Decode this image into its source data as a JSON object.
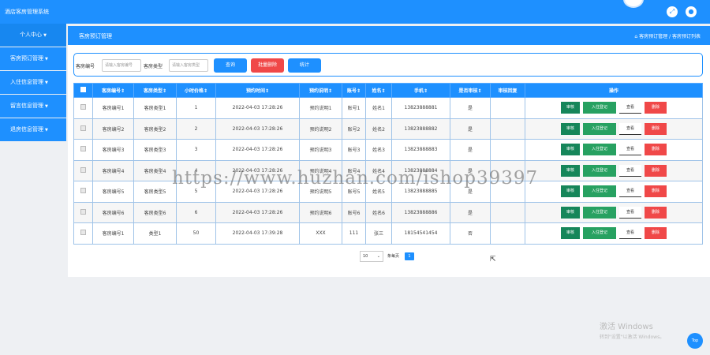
{
  "app": {
    "title": "酒店客房管理系统"
  },
  "colors": {
    "primary": "#1e90ff",
    "audit": "#16865a",
    "checkin": "#27a161",
    "delete": "#f04848"
  },
  "sidebar": {
    "items": [
      {
        "label": "个人中心"
      },
      {
        "label": "客房预订管理"
      },
      {
        "label": "入住信息管理"
      },
      {
        "label": "留言信息管理"
      },
      {
        "label": "退房信息管理"
      }
    ]
  },
  "page": {
    "title": "客房预订管理",
    "breadcrumb": "客房预订管理 / 客房预订列表"
  },
  "search": {
    "room_no_label": "客房编号",
    "room_no_placeholder": "请输入客房编号",
    "room_type_label": "客房类型",
    "room_type_placeholder": "请输入客房类型",
    "query_button": "查询",
    "batch_delete_button": "批量删除",
    "stats_button": "统计"
  },
  "table": {
    "headers": [
      "客房编号",
      "客房类型",
      "小时价格",
      "预约时间",
      "预约说明",
      "账号",
      "姓名",
      "手机",
      "是否审核",
      "审核回复",
      "操作"
    ],
    "actions": {
      "audit": "审核",
      "checkin": "入住登记",
      "view": "查看",
      "delete": "删除"
    },
    "rows": [
      [
        "客房编号1",
        "客房类型1",
        "1",
        "2022-04-03 17:28:26",
        "预约说明1",
        "账号1",
        "姓名1",
        "13823888881",
        "是",
        ""
      ],
      [
        "客房编号2",
        "客房类型2",
        "2",
        "2022-04-03 17:28:26",
        "预约说明2",
        "账号2",
        "姓名2",
        "13823888882",
        "是",
        ""
      ],
      [
        "客房编号3",
        "客房类型3",
        "3",
        "2022-04-03 17:28:26",
        "预约说明3",
        "账号3",
        "姓名3",
        "13823888883",
        "是",
        ""
      ],
      [
        "客房编号4",
        "客房类型4",
        "4",
        "2022-04-03 17:28:26",
        "预约说明4",
        "账号4",
        "姓名4",
        "13823888884",
        "是",
        ""
      ],
      [
        "客房编号5",
        "客房类型5",
        "5",
        "2022-04-03 17:28:26",
        "预约说明5",
        "账号5",
        "姓名5",
        "13823888885",
        "是",
        ""
      ],
      [
        "客房编号6",
        "客房类型6",
        "6",
        "2022-04-03 17:28:26",
        "预约说明6",
        "账号6",
        "姓名6",
        "13823888886",
        "是",
        ""
      ],
      [
        "客房编号1",
        "类型1",
        "50",
        "2022-04-03 17:39:28",
        "XXX",
        "111",
        "张三",
        "18154541454",
        "否",
        ""
      ]
    ]
  },
  "pagination": {
    "page_size": "10",
    "per_page_label": "条每页",
    "current_page": "1"
  },
  "watermark": "https://www.huzhan.com/ishop39397",
  "activation": {
    "line1": "激活 Windows",
    "line2": "转到\"设置\"以激活 Windows。"
  },
  "top_button": "Top"
}
